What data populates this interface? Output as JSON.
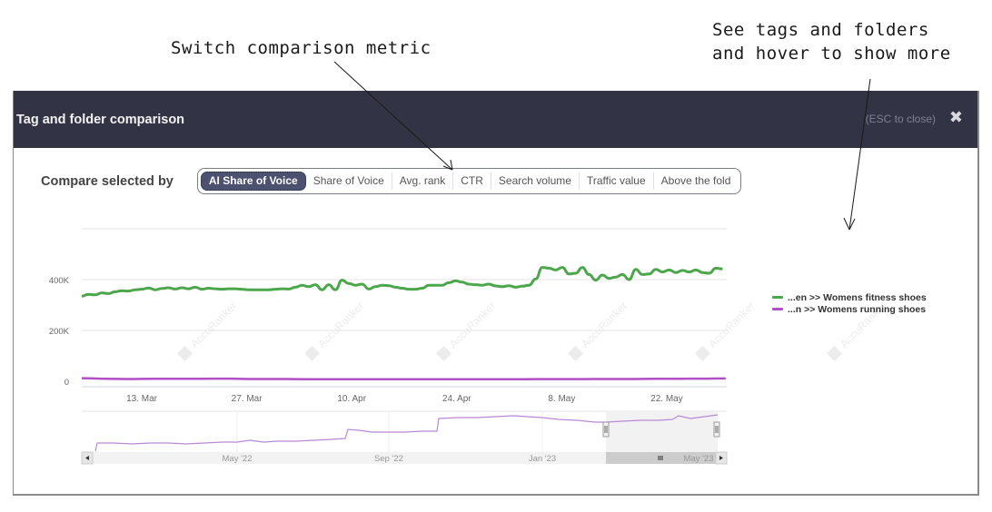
{
  "annotations": [
    {
      "text": "Switch comparison metric"
    },
    {
      "text": "See tags and folders\nand hover to show more"
    }
  ],
  "modal": {
    "title": "Tag and folder comparison",
    "esc_hint": "(ESC to close)",
    "close_icon": "close-x-icon"
  },
  "compare": {
    "label": "Compare selected by",
    "options": [
      {
        "label": "AI Share of Voice",
        "active": true
      },
      {
        "label": "Share of Voice",
        "active": false
      },
      {
        "label": "Avg. rank",
        "active": false
      },
      {
        "label": "CTR",
        "active": false
      },
      {
        "label": "Search volume",
        "active": false
      },
      {
        "label": "Traffic value",
        "active": false
      },
      {
        "label": "Above the fold",
        "active": false
      }
    ]
  },
  "watermark": "AccuRanker",
  "chart_data": {
    "type": "line",
    "title": "",
    "xlabel": "",
    "ylabel": "",
    "ylim": [
      0,
      600000
    ],
    "yticks": [
      {
        "value": 0,
        "label": "0"
      },
      {
        "value": 200000,
        "label": "200K"
      },
      {
        "value": 400000,
        "label": "400K"
      }
    ],
    "xticks": [
      {
        "day": 8,
        "label": "13. Mar"
      },
      {
        "day": 22,
        "label": "27. Mar"
      },
      {
        "day": 36,
        "label": "10. Apr"
      },
      {
        "day": 50,
        "label": "24. Apr"
      },
      {
        "day": 64,
        "label": "8. May"
      },
      {
        "day": 78,
        "label": "22. May"
      }
    ],
    "x_range_days": [
      0,
      86
    ],
    "grid": true,
    "legend_position": "right",
    "series": [
      {
        "name": "...en >> Womens fitness shoes",
        "color": "#4ca64c",
        "values": [
          335000,
          342000,
          340000,
          348000,
          345000,
          352000,
          356000,
          355000,
          360000,
          362000,
          367000,
          360000,
          365000,
          368000,
          363000,
          368000,
          364000,
          370000,
          362000,
          366000,
          364000,
          362000,
          364000,
          364000,
          362000,
          360000,
          360000,
          360000,
          360000,
          362000,
          364000,
          363000,
          370000,
          378000,
          372000,
          380000,
          360000,
          380000,
          360000,
          398000,
          385000,
          378000,
          382000,
          363000,
          372000,
          378000,
          376000,
          370000,
          366000,
          362000,
          362000,
          366000,
          378000,
          378000,
          378000,
          388000,
          395000,
          390000,
          382000,
          380000,
          378000,
          382000,
          375000,
          372000,
          376000,
          370000,
          374000,
          378000,
          402000,
          448000,
          445000,
          438000,
          448000,
          422000,
          425000,
          448000,
          420000,
          398000,
          418000,
          405000,
          410000,
          420000,
          400000,
          440000,
          420000,
          422000,
          440000,
          430000,
          438000,
          428000,
          436000,
          430000,
          438000,
          428000,
          425000,
          445000,
          442000
        ],
        "x_step_days": 0.89
      },
      {
        "name": "...n >> Womens running shoes",
        "color": "#b14fc5",
        "values": [
          12000,
          10000,
          9000,
          10000,
          9500,
          10000,
          10500,
          9000,
          9000,
          8500,
          8000,
          8000,
          8000,
          8000,
          8000,
          8000,
          8000,
          8000,
          8000,
          8500,
          8500,
          8500,
          9000,
          9000,
          9500,
          10000,
          10500,
          11000
        ],
        "x_step_days": 3.18
      }
    ],
    "navigator": {
      "tick_labels": [
        "May '22",
        "Sep '22",
        "Jan '23",
        "May '23"
      ],
      "series_color": "#b98ad6",
      "selected_range": "Mar '23 – May '23"
    }
  }
}
